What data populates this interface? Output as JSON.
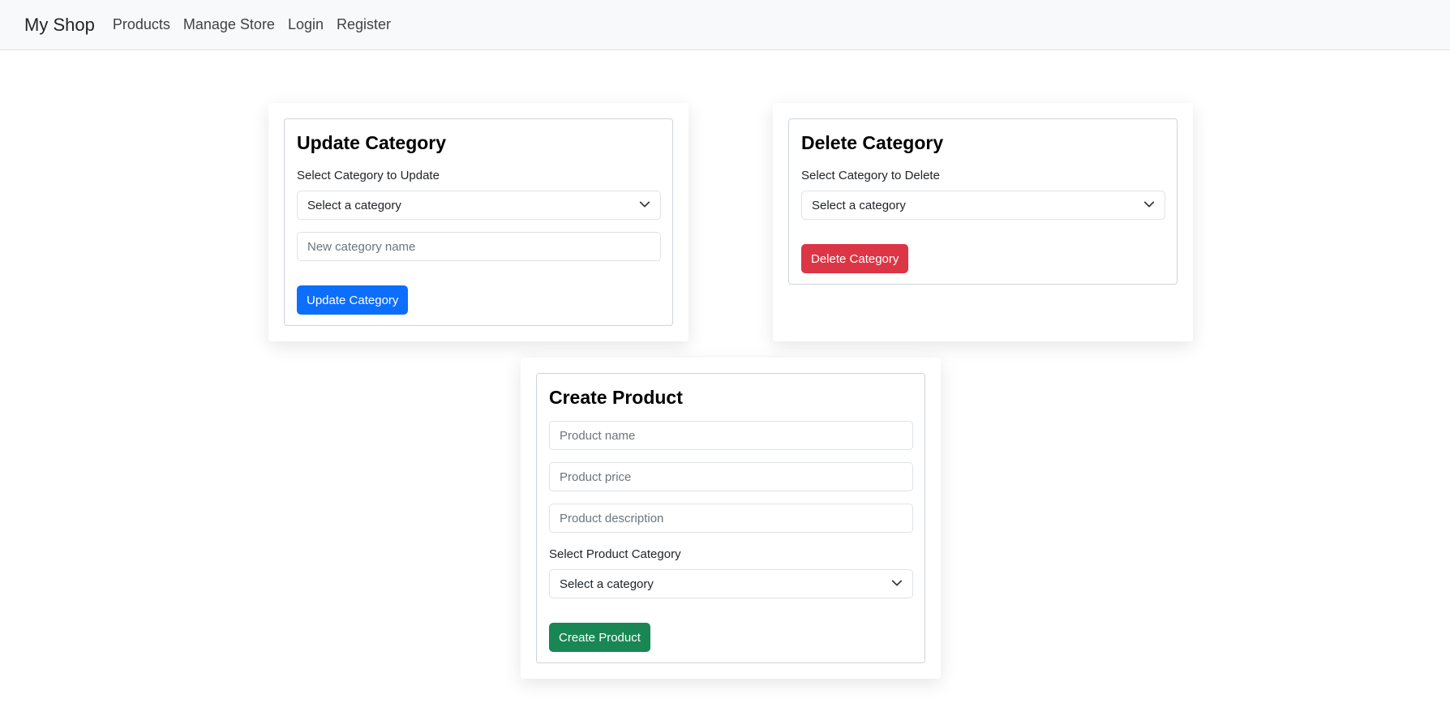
{
  "navbar": {
    "brand": "My Shop",
    "links": [
      "Products",
      "Manage Store",
      "Login",
      "Register"
    ]
  },
  "update_category": {
    "title": "Update Category",
    "select_label": "Select Category to Update",
    "select_value": "Select a category",
    "name_placeholder": "New category name",
    "button_label": "Update Category",
    "button_color": "#0d6efd"
  },
  "delete_category": {
    "title": "Delete Category",
    "select_label": "Select Category to Delete",
    "select_value": "Select a category",
    "button_label": "Delete Category",
    "button_color": "#dc3545"
  },
  "create_product": {
    "title": "Create Product",
    "name_placeholder": "Product name",
    "price_placeholder": "Product price",
    "description_placeholder": "Product description",
    "select_label": "Select Product Category",
    "select_value": "Select a category",
    "button_label": "Create Product",
    "button_color": "#198754"
  }
}
